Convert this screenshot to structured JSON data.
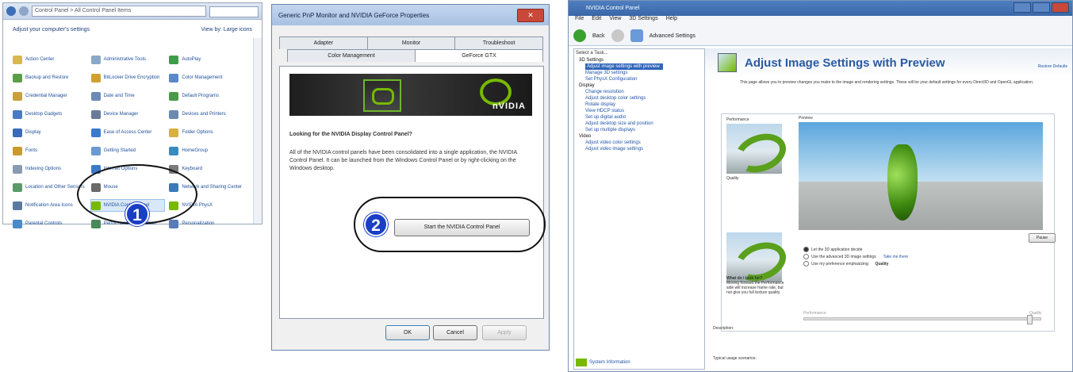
{
  "step1": {
    "badge": "1",
    "address": "Control Panel > All Control Panel Items",
    "header_left": "Adjust your computer's settings",
    "header_right": "View by: Large icons",
    "items": [
      {
        "label": "Action Center",
        "color": "#d8b84a"
      },
      {
        "label": "Administrative Tools",
        "color": "#8aa8c8"
      },
      {
        "label": "AutoPlay",
        "color": "#3f9c4a"
      },
      {
        "label": "Backup and Restore",
        "color": "#5a9e4a"
      },
      {
        "label": "BitLocker Drive Encryption",
        "color": "#d0a030"
      },
      {
        "label": "Color Management",
        "color": "#5a88c8"
      },
      {
        "label": "Credential Manager",
        "color": "#c8a040"
      },
      {
        "label": "Date and Time",
        "color": "#6a8ab8"
      },
      {
        "label": "Default Programs",
        "color": "#4a9a4a"
      },
      {
        "label": "Desktop Gadgets",
        "color": "#4a7ac0"
      },
      {
        "label": "Device Manager",
        "color": "#6a7a9a"
      },
      {
        "label": "Devices and Printers",
        "color": "#6a8ab0"
      },
      {
        "label": "Display",
        "color": "#3a6ab8"
      },
      {
        "label": "Ease of Access Center",
        "color": "#3a7ad0"
      },
      {
        "label": "Folder Options",
        "color": "#d8b040"
      },
      {
        "label": "Fonts",
        "color": "#c89a30"
      },
      {
        "label": "Getting Started",
        "color": "#6a9ad0"
      },
      {
        "label": "HomeGroup",
        "color": "#3a8ac0"
      },
      {
        "label": "Indexing Options",
        "color": "#8a9ab0"
      },
      {
        "label": "Internet Options",
        "color": "#3a7ac8"
      },
      {
        "label": "Keyboard",
        "color": "#7a7a7a"
      },
      {
        "label": "Location and Other Sensors",
        "color": "#5a9a6a"
      },
      {
        "label": "Mouse",
        "color": "#6a6a6a"
      },
      {
        "label": "Network and Sharing Center",
        "color": "#3a7ab8"
      },
      {
        "label": "Notification Area Icons",
        "color": "#5a7aa0"
      },
      {
        "label": "NVIDIA Control Panel",
        "color": "#76b900"
      },
      {
        "label": "NVIDIA PhysX",
        "color": "#76b900"
      },
      {
        "label": "Parental Controls",
        "color": "#4a8ac8"
      },
      {
        "label": "Performance Information",
        "color": "#4a8a5a"
      },
      {
        "label": "Personalization",
        "color": "#5a7ab8"
      }
    ],
    "highlight_index": 25
  },
  "step2": {
    "badge": "2",
    "title": "Generic PnP Monitor and NVIDIA GeForce Properties",
    "close": "✕",
    "tabs_row1": [
      "Adapter",
      "Monitor",
      "Troubleshoot"
    ],
    "tabs_row2": [
      "Color Management",
      "GeForce GTX"
    ],
    "banner_logo": "nVIDIA",
    "question": "Looking for the NVIDIA Display Control Panel?",
    "paragraph": "All of the NVIDIA control panels have been consolidated into a single application, the NVIDIA Control Panel. It can be launched from the Windows Control Panel or by right-clicking on the Windows desktop.",
    "start_button": "Start the NVIDIA Control Panel",
    "ok": "OK",
    "cancel": "Cancel",
    "apply": "Apply"
  },
  "step3": {
    "title": "NVIDIA Control Panel",
    "menu": [
      "File",
      "Edit",
      "View",
      "3D Settings",
      "Help"
    ],
    "back": "Back",
    "advanced": "Advanced Settings",
    "tree_title": "Select a Task...",
    "tree": [
      {
        "label": "3D Settings",
        "type": "cat"
      },
      {
        "label": "Adjust image settings with preview",
        "type": "sel"
      },
      {
        "label": "Manage 3D settings",
        "type": "node"
      },
      {
        "label": "Set PhysX Configuration",
        "type": "node"
      },
      {
        "label": "Display",
        "type": "cat"
      },
      {
        "label": "Change resolution",
        "type": "node"
      },
      {
        "label": "Adjust desktop color settings",
        "type": "node"
      },
      {
        "label": "Rotate display",
        "type": "node"
      },
      {
        "label": "View HDCP status",
        "type": "node"
      },
      {
        "label": "Set up digital audio",
        "type": "node"
      },
      {
        "label": "Adjust desktop size and position",
        "type": "node"
      },
      {
        "label": "Set up multiple displays",
        "type": "node"
      },
      {
        "label": "Video",
        "type": "cat"
      },
      {
        "label": "Adjust video color settings",
        "type": "node"
      },
      {
        "label": "Adjust video image settings",
        "type": "node"
      }
    ],
    "system_info": "System Information",
    "heading": "Adjust Image Settings with Preview",
    "restore": "Restore Defaults",
    "description": "This page allows you to preview changes you make to the image and rendering settings. These will be your default settings for every Direct3D and OpenGL application.",
    "performance": "Performance",
    "quality": "Quality",
    "preview": "Preview",
    "pause": "Pause",
    "side_title": "What do I look for?",
    "side_text": "Moving forward the Performance side will increase frame rate, but not give you full texture quality.",
    "opt1": "Let the 3D application decide",
    "opt2": "Use the advanced 3D image settings",
    "opt2_link": "Take me there",
    "opt3": "Use my preference emphasizing:",
    "opt3_val": "Quality",
    "slider_left": "Performance",
    "slider_right": "Quality",
    "desc_label": "Description:",
    "usage": "Typical usage scenarios:"
  }
}
